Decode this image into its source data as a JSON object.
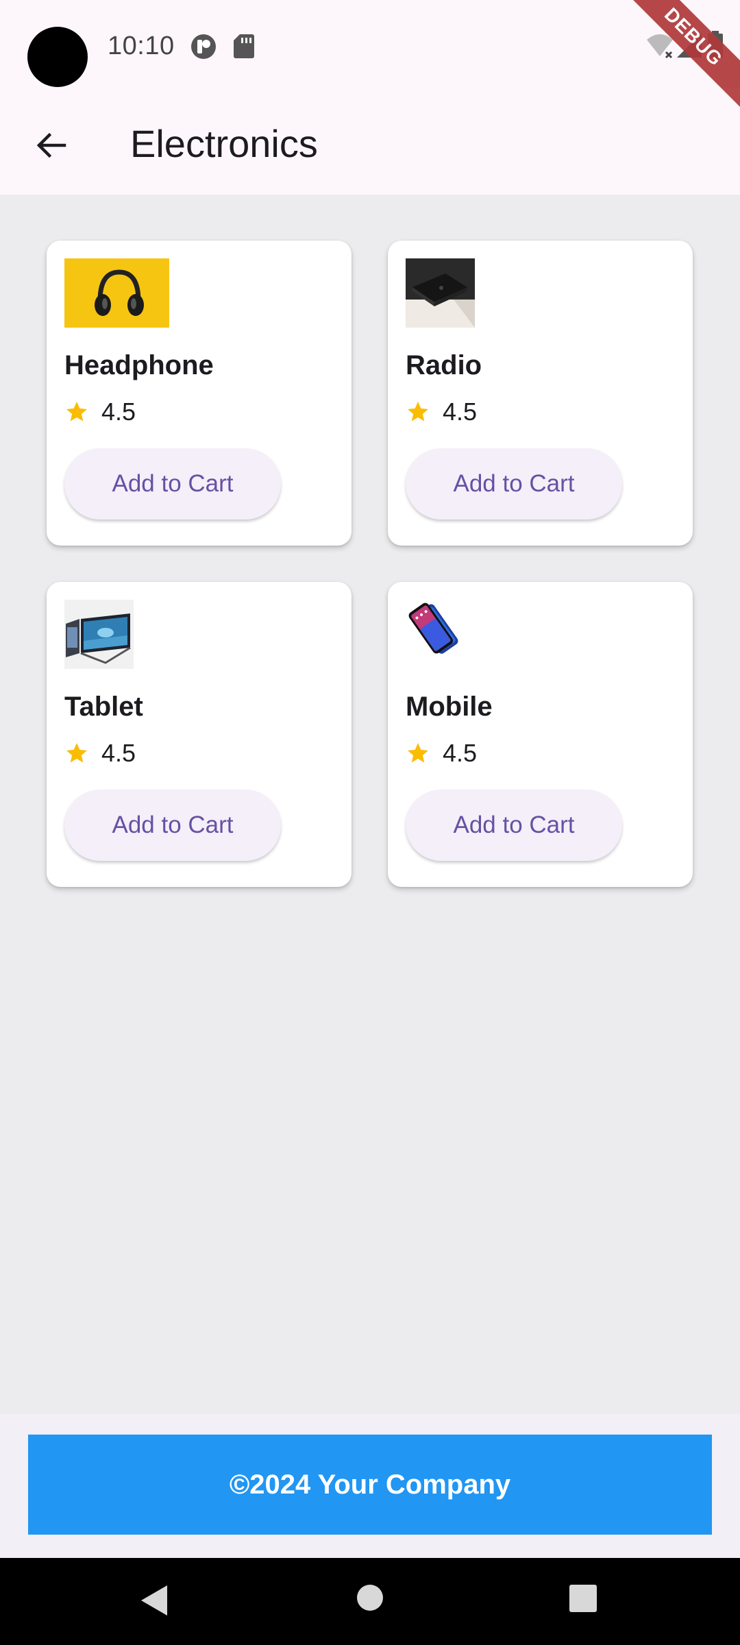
{
  "status_bar": {
    "time": "10:10",
    "icons": [
      "notification-icon",
      "sd-card-icon",
      "wifi-off-icon",
      "signal-icon",
      "battery-icon"
    ]
  },
  "debug_banner": "DEBUG",
  "app_bar": {
    "back_icon": "arrow-back-icon",
    "title": "Electronics"
  },
  "products": [
    {
      "name": "Headphone",
      "rating": "4.5",
      "button": "Add to Cart",
      "image": "headphone-image"
    },
    {
      "name": "Radio",
      "rating": "4.5",
      "button": "Add to Cart",
      "image": "radio-image"
    },
    {
      "name": "Tablet",
      "rating": "4.5",
      "button": "Add to Cart",
      "image": "tablet-image"
    },
    {
      "name": "Mobile",
      "rating": "4.5",
      "button": "Add to Cart",
      "image": "mobile-image"
    }
  ],
  "footer": {
    "text": "©2024 Your Company"
  },
  "colors": {
    "accent": "#6750a4",
    "star": "#fbbc05",
    "footer_bg": "#2196f3",
    "app_bar_bg": "#fdf7fc",
    "page_bg": "#ececee"
  },
  "nav_bar": {
    "icons": [
      "back-triangle-icon",
      "home-circle-icon",
      "recents-square-icon"
    ]
  }
}
